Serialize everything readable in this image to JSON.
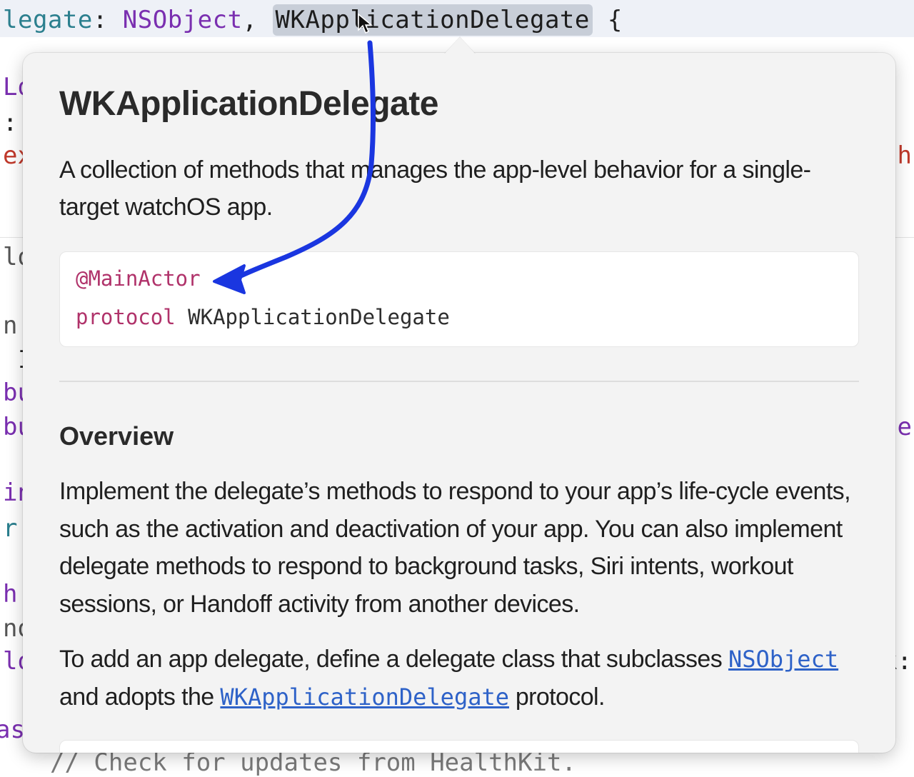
{
  "editor": {
    "top_line": {
      "prefix": "legate",
      "colon": ": ",
      "superclass": "NSObject",
      "comma": ", ",
      "selected_token": "WKApplicationDelegate",
      "brace": " {"
    },
    "left_fragments": [
      {
        "text": "Lo",
        "color": "#7a2fb0"
      },
      {
        "text": ":",
        "color": "#222222"
      },
      {
        "text": "ex",
        "color": "#c0392b"
      },
      {
        "text": "lo",
        "color": "#555555"
      },
      {
        "text": "n",
        "color": "#555555"
      },
      {
        "text": ", I",
        "color": "#222222"
      },
      {
        "text": "bu",
        "color": "#7a2fb0"
      },
      {
        "text": "bu",
        "color": "#7a2fb0"
      },
      {
        "text": "in",
        "color": "#7a2fb0"
      },
      {
        "text": "r",
        "color": "#2b7f8e"
      },
      {
        "text": "h",
        "color": "#7a2fb0"
      },
      {
        "text": "no",
        "color": "#555555"
      },
      {
        "text": "lo",
        "color": "#7a2fb0"
      },
      {
        "text": "as",
        "color": "#7a2fb0"
      }
    ],
    "right_fragments": [
      {
        "text": "ch",
        "color": "#c0392b"
      },
      {
        "text": "te",
        "color": "#7a2fb0"
      },
      {
        "text": "k:",
        "color": "#222222"
      }
    ],
    "bottom_line": "// Check for updates from HealthKit."
  },
  "popover": {
    "title": "WKApplicationDelegate",
    "summary": "A collection of methods that manages the app-level behavior for a single-target watchOS app.",
    "declaration": {
      "attribute": "@MainActor",
      "keyword": "protocol",
      "name": "WKApplicationDelegate"
    },
    "overview_heading": "Overview",
    "overview_p1": "Implement the delegate’s methods to respond to your app’s life-cycle events, such as the activation and deactivation of your app. You can also implement delegate methods to respond to background tasks, Siri intents, workout sessions, or Handoff activity from another devices.",
    "overview_p2": {
      "prefix": "To add an app delegate, define a delegate class that subclasses ",
      "link1": "NSObject",
      "middle": " and adopts the ",
      "link2": "WKApplicationDelegate",
      "suffix": " protocol."
    }
  },
  "colors": {
    "keyword_pink": "#b0326a",
    "link_blue": "#2e62c8",
    "annotation_blue": "#1a36e0",
    "popover_bg": "#f3f3f3"
  },
  "icons": {
    "cursor": "arrow-pointer-icon",
    "annotation": "hand-drawn-arrow-icon"
  }
}
